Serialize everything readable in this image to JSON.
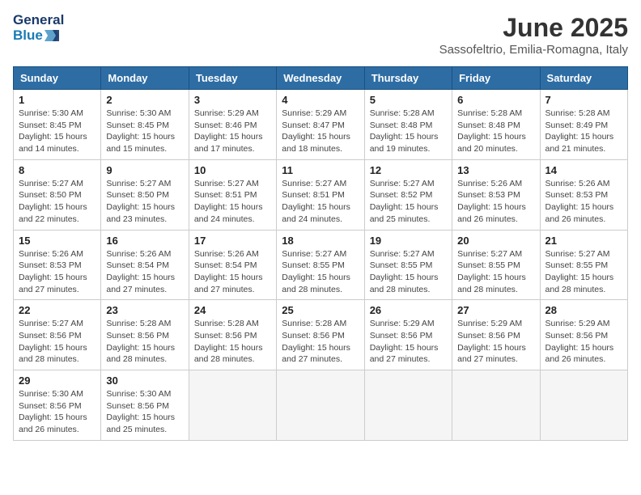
{
  "header": {
    "logo_line1": "General",
    "logo_line2": "Blue",
    "title": "June 2025",
    "subtitle": "Sassofeltrio, Emilia-Romagna, Italy"
  },
  "weekdays": [
    "Sunday",
    "Monday",
    "Tuesday",
    "Wednesday",
    "Thursday",
    "Friday",
    "Saturday"
  ],
  "weeks": [
    [
      {
        "day": "1",
        "info": "Sunrise: 5:30 AM\nSunset: 8:45 PM\nDaylight: 15 hours and 14 minutes."
      },
      {
        "day": "2",
        "info": "Sunrise: 5:30 AM\nSunset: 8:45 PM\nDaylight: 15 hours and 15 minutes."
      },
      {
        "day": "3",
        "info": "Sunrise: 5:29 AM\nSunset: 8:46 PM\nDaylight: 15 hours and 17 minutes."
      },
      {
        "day": "4",
        "info": "Sunrise: 5:29 AM\nSunset: 8:47 PM\nDaylight: 15 hours and 18 minutes."
      },
      {
        "day": "5",
        "info": "Sunrise: 5:28 AM\nSunset: 8:48 PM\nDaylight: 15 hours and 19 minutes."
      },
      {
        "day": "6",
        "info": "Sunrise: 5:28 AM\nSunset: 8:48 PM\nDaylight: 15 hours and 20 minutes."
      },
      {
        "day": "7",
        "info": "Sunrise: 5:28 AM\nSunset: 8:49 PM\nDaylight: 15 hours and 21 minutes."
      }
    ],
    [
      {
        "day": "8",
        "info": "Sunrise: 5:27 AM\nSunset: 8:50 PM\nDaylight: 15 hours and 22 minutes."
      },
      {
        "day": "9",
        "info": "Sunrise: 5:27 AM\nSunset: 8:50 PM\nDaylight: 15 hours and 23 minutes."
      },
      {
        "day": "10",
        "info": "Sunrise: 5:27 AM\nSunset: 8:51 PM\nDaylight: 15 hours and 24 minutes."
      },
      {
        "day": "11",
        "info": "Sunrise: 5:27 AM\nSunset: 8:51 PM\nDaylight: 15 hours and 24 minutes."
      },
      {
        "day": "12",
        "info": "Sunrise: 5:27 AM\nSunset: 8:52 PM\nDaylight: 15 hours and 25 minutes."
      },
      {
        "day": "13",
        "info": "Sunrise: 5:26 AM\nSunset: 8:53 PM\nDaylight: 15 hours and 26 minutes."
      },
      {
        "day": "14",
        "info": "Sunrise: 5:26 AM\nSunset: 8:53 PM\nDaylight: 15 hours and 26 minutes."
      }
    ],
    [
      {
        "day": "15",
        "info": "Sunrise: 5:26 AM\nSunset: 8:53 PM\nDaylight: 15 hours and 27 minutes."
      },
      {
        "day": "16",
        "info": "Sunrise: 5:26 AM\nSunset: 8:54 PM\nDaylight: 15 hours and 27 minutes."
      },
      {
        "day": "17",
        "info": "Sunrise: 5:26 AM\nSunset: 8:54 PM\nDaylight: 15 hours and 27 minutes."
      },
      {
        "day": "18",
        "info": "Sunrise: 5:27 AM\nSunset: 8:55 PM\nDaylight: 15 hours and 28 minutes."
      },
      {
        "day": "19",
        "info": "Sunrise: 5:27 AM\nSunset: 8:55 PM\nDaylight: 15 hours and 28 minutes."
      },
      {
        "day": "20",
        "info": "Sunrise: 5:27 AM\nSunset: 8:55 PM\nDaylight: 15 hours and 28 minutes."
      },
      {
        "day": "21",
        "info": "Sunrise: 5:27 AM\nSunset: 8:55 PM\nDaylight: 15 hours and 28 minutes."
      }
    ],
    [
      {
        "day": "22",
        "info": "Sunrise: 5:27 AM\nSunset: 8:56 PM\nDaylight: 15 hours and 28 minutes."
      },
      {
        "day": "23",
        "info": "Sunrise: 5:28 AM\nSunset: 8:56 PM\nDaylight: 15 hours and 28 minutes."
      },
      {
        "day": "24",
        "info": "Sunrise: 5:28 AM\nSunset: 8:56 PM\nDaylight: 15 hours and 28 minutes."
      },
      {
        "day": "25",
        "info": "Sunrise: 5:28 AM\nSunset: 8:56 PM\nDaylight: 15 hours and 27 minutes."
      },
      {
        "day": "26",
        "info": "Sunrise: 5:29 AM\nSunset: 8:56 PM\nDaylight: 15 hours and 27 minutes."
      },
      {
        "day": "27",
        "info": "Sunrise: 5:29 AM\nSunset: 8:56 PM\nDaylight: 15 hours and 27 minutes."
      },
      {
        "day": "28",
        "info": "Sunrise: 5:29 AM\nSunset: 8:56 PM\nDaylight: 15 hours and 26 minutes."
      }
    ],
    [
      {
        "day": "29",
        "info": "Sunrise: 5:30 AM\nSunset: 8:56 PM\nDaylight: 15 hours and 26 minutes."
      },
      {
        "day": "30",
        "info": "Sunrise: 5:30 AM\nSunset: 8:56 PM\nDaylight: 15 hours and 25 minutes."
      },
      {
        "day": "",
        "info": ""
      },
      {
        "day": "",
        "info": ""
      },
      {
        "day": "",
        "info": ""
      },
      {
        "day": "",
        "info": ""
      },
      {
        "day": "",
        "info": ""
      }
    ]
  ]
}
